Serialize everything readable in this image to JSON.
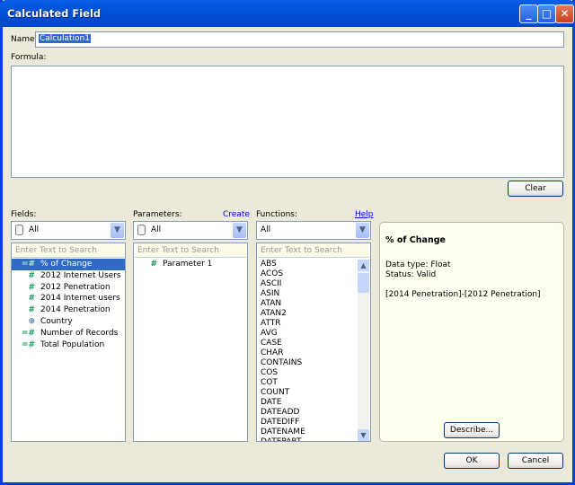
{
  "window": {
    "title": "Calculated Field",
    "minimize": "_",
    "maximize": "□",
    "close": "✕"
  },
  "name": {
    "label": "Name:",
    "value": "Calculation1"
  },
  "formula": {
    "label": "Formula:",
    "value": ""
  },
  "clear_label": "Clear",
  "fields": {
    "label": "Fields:",
    "filter": "All",
    "search_placeholder": "Enter Text to Search",
    "items": [
      {
        "label": "% of Change",
        "icon": "=#",
        "selected": true
      },
      {
        "label": "2012 Internet Users",
        "icon": "#"
      },
      {
        "label": "2012 Penetration",
        "icon": "#"
      },
      {
        "label": "2014 Internet users",
        "icon": "#"
      },
      {
        "label": "2014 Penetration",
        "icon": "#"
      },
      {
        "label": "Country",
        "icon": "⊕"
      },
      {
        "label": "Number of Records",
        "icon": "=#"
      },
      {
        "label": "Total Population",
        "icon": "=#"
      }
    ]
  },
  "parameters": {
    "label": "Parameters:",
    "create_link": "Create",
    "filter": "All",
    "search_placeholder": "Enter Text to Search",
    "items": [
      {
        "label": "Parameter 1",
        "icon": "#"
      }
    ]
  },
  "functions": {
    "label": "Functions:",
    "help_link": "Help",
    "filter": "All",
    "search_placeholder": "Enter Text to Search",
    "items": [
      "ABS",
      "ACOS",
      "ASCII",
      "ASIN",
      "ATAN",
      "ATAN2",
      "ATTR",
      "AVG",
      "CASE",
      "CHAR",
      "CONTAINS",
      "COS",
      "COT",
      "COUNT",
      "DATE",
      "DATEADD",
      "DATEDIFF",
      "DATENAME",
      "DATEPART"
    ]
  },
  "details": {
    "title": "% of Change",
    "data_type": "Data type: Float",
    "status": "Status: Valid",
    "formula": "[2014 Penetration]-[2012 Penetration]",
    "describe_label": "Describe..."
  },
  "ok_label": "OK",
  "cancel_label": "Cancel"
}
